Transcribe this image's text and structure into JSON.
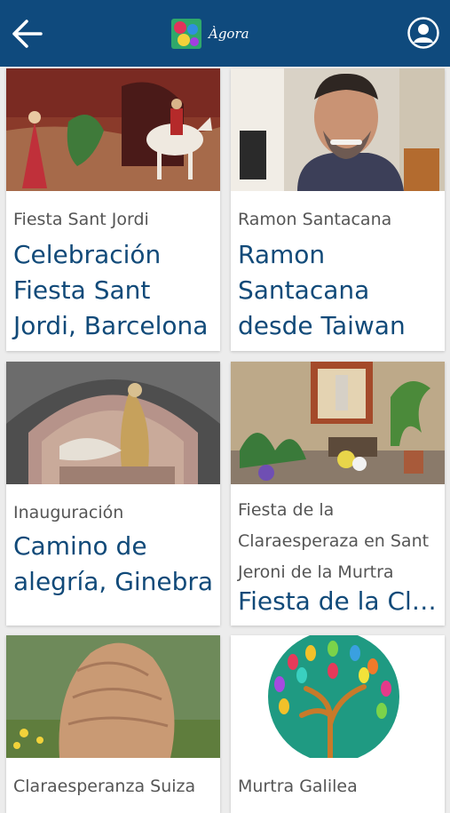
{
  "header": {
    "back_icon": "arrow-left-icon",
    "app_title": "Àgora",
    "logo_icon": "agora-logo",
    "profile_icon": "user-circle-icon",
    "bar_color": "#0f4a7d"
  },
  "cards": [
    {
      "category": "Fiesta Sant Jordi",
      "title": "Celebración Fiesta Sant Jordi, Barcelona",
      "image": "sant-jordi-painting"
    },
    {
      "category": "Ramon Santacana",
      "title": "Ramon Santacana desde Taiwan",
      "image": "man-video-call"
    },
    {
      "category": "Inauguración",
      "title": "Camino de alegría, Ginebra",
      "image": "mosaic-arch"
    },
    {
      "category": "Fiesta de la Claraesperaza en Sant Jeroni de la Murtra",
      "title": "Fiesta de la Claraesperanza",
      "image": "garden-altar"
    },
    {
      "category": "Claraesperanza Suiza",
      "title": "",
      "image": "wood-sculpture"
    },
    {
      "category": "Murtra Galilea",
      "title": "",
      "image": "tree-logo"
    }
  ],
  "colors": {
    "title": "#114a79",
    "category": "#555555",
    "background": "#ececec"
  }
}
